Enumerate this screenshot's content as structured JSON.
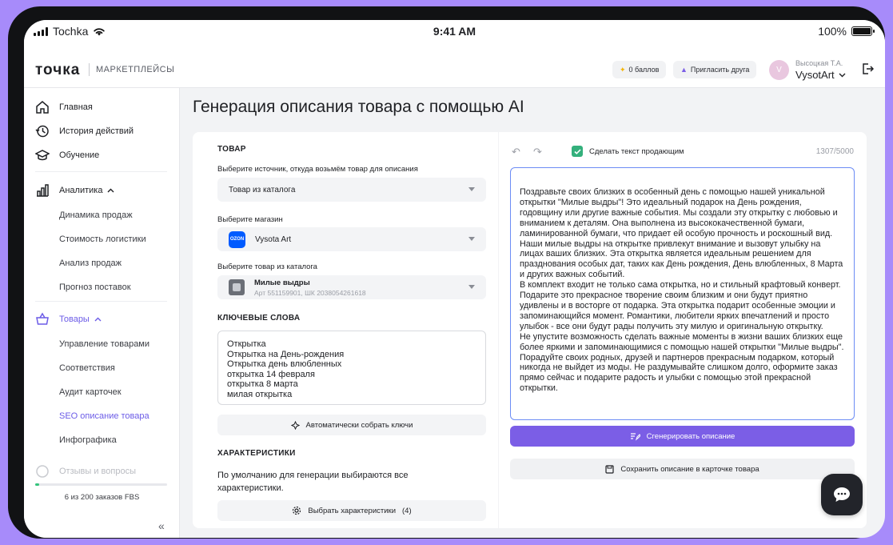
{
  "status_bar": {
    "carrier": "Tochka",
    "time": "9:41 AM",
    "battery": "100%",
    "battery_level": 100
  },
  "header": {
    "logo": "точка",
    "section": "МАРКЕТПЛЕЙСЫ",
    "points_label": "0 баллов",
    "invite_label": "Пригласить друга",
    "avatar_letter": "V",
    "user_name": "Высоцкая Т.А.",
    "shop_name": "VysotArt"
  },
  "sidebar": {
    "main_items": [
      {
        "label": "Главная",
        "icon": "home-icon"
      },
      {
        "label": "История действий",
        "icon": "history-icon"
      },
      {
        "label": "Обучение",
        "icon": "graduation-cap-icon"
      }
    ],
    "analytics": {
      "label": "Аналитика",
      "items": [
        "Динамика продаж",
        "Стоимость логистики",
        "Анализ продаж",
        "Прогноз поставок"
      ]
    },
    "goods": {
      "label": "Товары",
      "items": [
        "Управление товарами",
        "Соответствия",
        "Аудит карточек",
        "SEO описание товара",
        "Инфографика"
      ],
      "active_index": 3
    },
    "faded_item": "Отзывы и вопросы",
    "fbs_text": "6 из 200 заказов FBS",
    "fbs_progress": 0.03
  },
  "page": {
    "title": "Генерация описания товара с помощью AI"
  },
  "form": {
    "product_section": "ТОВАР",
    "source_label": "Выберите источник, откуда возьмём товар для описания",
    "source_value": "Товар из каталога",
    "shop_label": "Выберите магазин",
    "shop_value": "Vysota Art",
    "ozon_badge": "OZON",
    "catalog_label": "Выберите товар из каталога",
    "product_name": "Милые выдры",
    "product_meta": "Арт 551159901, ШК 2038054261618",
    "keywords_section": "КЛЮЧЕВЫЕ СЛОВА",
    "keywords": [
      "Открытка",
      "Открытка на День-рождения",
      "Открытка день влюбленных",
      "открытка 14 февраля",
      "открытка 8 марта",
      "милая открытка"
    ],
    "auto_keys_label": "Автоматически собрать ключи",
    "characteristics_section": "ХАРАКТЕРИСТИКИ",
    "characteristics_desc": "По умолчанию для генерации выбираются все характеристики.",
    "choose_chars_label": "Выбрать характеристики",
    "chars_count": "(4)"
  },
  "editor": {
    "selling_text_label": "Сделать текст продающим",
    "counter": "1307/5000",
    "paragraphs": [
      "Поздравьте своих близких в особенный день с помощью нашей уникальной открытки \"Милые выдры\"! Это идеальный подарок на День рождения, годовщину или другие важные события. Мы создали эту открытку с любовью и вниманием к деталям. Она выполнена из высококачественной бумаги, ламинированной бумаги, что придает ей особую прочность и роскошный вид.",
      "Наши милые выдры на открытке привлекут внимание и вызовут улыбку на лицах ваших близких. Эта открытка является идеальным решением для празднования особых дат, таких как День рождения, День влюбленных, 8 Марта и других важных событий.",
      "В комплект входит не только сама открытка, но и стильный крафтовый конверт.",
      "Подарите это прекрасное творение своим близким и они будут приятно удивлены и в восторге от подарка. Эта открытка подарит особенные эмоции и запоминающийся момент. Романтики, любители ярких впечатлений и просто улыбок - все они будут рады получить эту милую и оригинальную открытку.",
      "Не упустите возможность сделать важные моменты в жизни ваших близких еще более яркими и запоминающимися с помощью нашей открытки \"Милые выдры\". Порадуйте своих родных, друзей и партнеров прекрасным подарком, который никогда не выйдет из моды. Не раздумывайте слишком долго, оформите заказ прямо сейчас и подарите радость и улыбки с помощью этой прекрасной открытки."
    ],
    "generate_label": "Сгенерировать описание",
    "save_label": "Сохранить описание в карточке товара"
  },
  "colors": {
    "accent": "#7b5ee6",
    "active_nav": "#6c5ce7",
    "checkbox": "#34b07c",
    "ozon": "#005bff"
  }
}
